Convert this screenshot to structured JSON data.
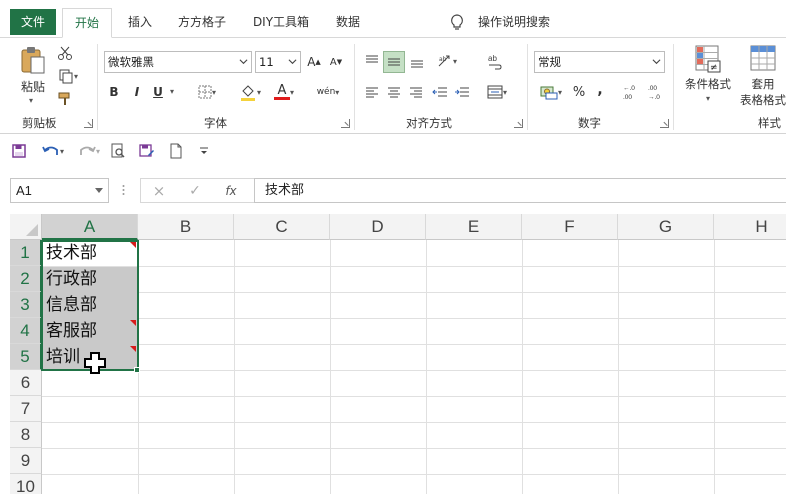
{
  "menu": {
    "file": "文件",
    "home": "开始",
    "insert": "插入",
    "ffgz": "方方格子",
    "diy": "DIY工具箱",
    "data": "数据",
    "tellme": "操作说明搜索"
  },
  "ribbon": {
    "clipboard": {
      "paste_label": "粘贴",
      "group_label": "剪贴板"
    },
    "font": {
      "name": "微软雅黑",
      "size": "11",
      "group_label": "字体",
      "bold": "B",
      "italic": "I",
      "underline": "U",
      "font_color_letter": "A",
      "phonetic": "wén"
    },
    "alignment": {
      "group_label": "对齐方式"
    },
    "number": {
      "format": "常规",
      "group_label": "数字",
      "percent": "%",
      "comma": ",",
      "inc_decimal": ".0→.00",
      "dec_decimal": ".00→.0"
    },
    "styles": {
      "cond_format": "条件格式",
      "table_format_1": "套用",
      "table_format_2": "表格格式",
      "group_label": "样式"
    },
    "colors": {
      "accent": "#217346",
      "font_red": "#e01c1c",
      "highlight": "#f4d23c"
    }
  },
  "formula_bar": {
    "name_box": "A1",
    "cancel": "×",
    "enter": "✓",
    "fx": "fx",
    "content": "技术部"
  },
  "sheet": {
    "columns": [
      "A",
      "B",
      "C",
      "D",
      "E",
      "F",
      "G",
      "H"
    ],
    "rows": [
      "1",
      "2",
      "3",
      "4",
      "5",
      "6",
      "7",
      "8",
      "9",
      "10"
    ],
    "cells": [
      "技术部",
      "行政部",
      "信息部",
      "客服部",
      "培训"
    ]
  }
}
